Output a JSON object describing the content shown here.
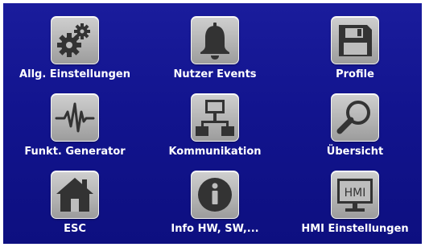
{
  "menu": {
    "items": [
      {
        "label": "Allg. Einstellungen",
        "icon": "gears-icon"
      },
      {
        "label": "Nutzer Events",
        "icon": "bell-icon"
      },
      {
        "label": "Profile",
        "icon": "floppy-disk-icon"
      },
      {
        "label": "Funkt. Generator",
        "icon": "waveform-icon"
      },
      {
        "label": "Kommunikation",
        "icon": "network-icon"
      },
      {
        "label": "Übersicht",
        "icon": "magnifier-icon"
      },
      {
        "label": "ESC",
        "icon": "home-icon"
      },
      {
        "label": "Info HW, SW,...",
        "icon": "info-icon"
      },
      {
        "label": "HMI Einstellungen",
        "icon": "hmi-monitor-icon",
        "icon_text": "HMI"
      }
    ]
  },
  "colors": {
    "background": "#12148e",
    "button": "#b4b4b4",
    "icon": "#333333",
    "label": "#ffffff"
  }
}
